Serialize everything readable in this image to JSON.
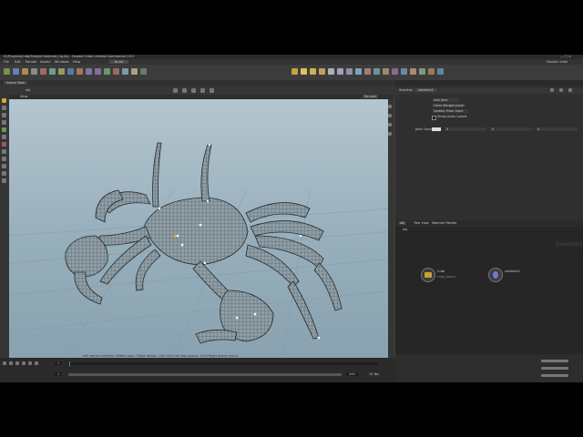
{
  "window": {
    "title": "D:/Projects/Crab/SimpleCrab/crab_rig.hip - Houdini Indie Limited-Commercial 19.5",
    "build": "Houdini Indie"
  },
  "menu": [
    "File",
    "Edit",
    "Render",
    "Assets",
    "Windows",
    "Help"
  ],
  "desktop_dropdown": "Build",
  "viewport": {
    "tab_label": "Scene View",
    "camera_label": "View",
    "cam_menu": "No cam",
    "status_text": "Left mouse tumbles. Middle pans. Right dollies. Ctrl+Alt+Left box-zooms. Ctrl+Right opens menu."
  },
  "parameters": {
    "node_type": "Skeleton",
    "node_name": "skeleton1",
    "buttons": [
      "Add Joint",
      "Clear Merged Joints",
      "Update From Input"
    ],
    "checkbox_label": "Show Joints Labels",
    "field_label": "Joint Color",
    "field_values": [
      "0",
      "0",
      "0"
    ]
  },
  "network": {
    "tabs": [
      "obj",
      "Tree View",
      "Material Palette"
    ],
    "path": "obj",
    "context_label": "Geometry",
    "nodes": [
      {
        "name": "Crab",
        "sublabel": "crab_bones",
        "color": "#c8a030"
      },
      {
        "name": "skeleton1",
        "sublabel": "",
        "color": "#6f7bd0"
      }
    ]
  },
  "timeline": {
    "current_frame": "1",
    "start_frame": "1",
    "end_frame": "240",
    "fps_label": "24 fps"
  },
  "colors": {
    "viewport_top": "#b4c6cf",
    "viewport_bottom": "#8aa2b0",
    "panel_bg": "#2f2f2f"
  }
}
